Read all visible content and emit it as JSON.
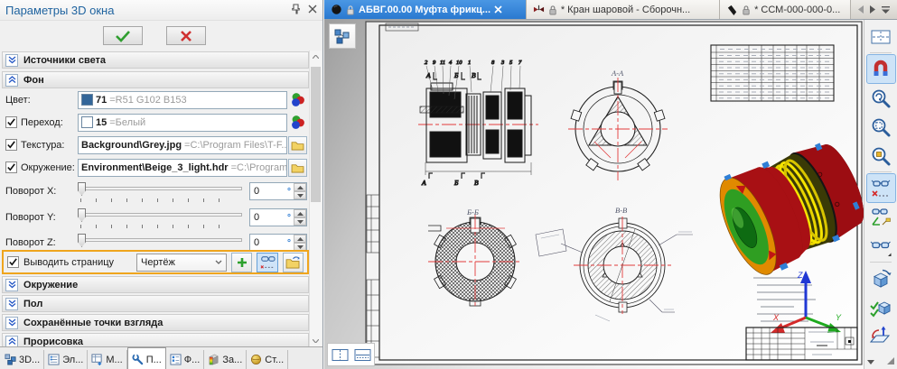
{
  "panel": {
    "title": "Параметры 3D окна",
    "sections": {
      "light_sources": "Источники света",
      "background": "Фон",
      "environment": "Окружение",
      "floor": "Пол",
      "saved_views": "Сохранённые точки взгляда",
      "rendering": "Прорисовка"
    },
    "fields": {
      "color": {
        "label": "Цвет:",
        "value": "71",
        "extra": "=R51 G102 B153",
        "swatch": "#336699"
      },
      "transition": {
        "label": "Переход:",
        "checked": true,
        "value": "15",
        "extra": "=Белый",
        "swatch": "#FFFFFF"
      },
      "texture": {
        "label": "Текстура:",
        "checked": true,
        "value": "Background\\Grey.jpg",
        "extra": "=C:\\Program Files\\T-F..."
      },
      "environment": {
        "label": "Окружение:",
        "checked": true,
        "value": "Environment\\Beige_3_light.hdr",
        "extra": "=C:\\Program..."
      },
      "rotate_x": {
        "label": "Поворот X:",
        "value": "0",
        "unit": "°"
      },
      "rotate_y": {
        "label": "Поворот Y:",
        "value": "0",
        "unit": "°"
      },
      "rotate_z": {
        "label": "Поворот Z:",
        "value": "0",
        "unit": "°"
      },
      "output_page": {
        "label": "Выводить страницу",
        "checked": true,
        "value": "Чертёж"
      }
    },
    "bottom_tabs": [
      {
        "label": "3D..."
      },
      {
        "label": "Эл..."
      },
      {
        "label": "М..."
      },
      {
        "label": "П...",
        "active": true
      },
      {
        "label": "Ф..."
      },
      {
        "label": "За..."
      },
      {
        "label": "Ст..."
      }
    ]
  },
  "document_tabs": [
    {
      "title": "АБВГ.00.00 Муфта фрикц...",
      "active": true
    },
    {
      "title": "* Кран шаровой - Сборочн..."
    },
    {
      "title": "* ССМ-000-000-0..."
    }
  ],
  "drawing": {
    "view_labels": {
      "aa": "А-А",
      "bb": "Б-Б",
      "vv": "В-В"
    },
    "position_numbers": [
      "2",
      "9",
      "11",
      "4",
      "10",
      "1",
      "8",
      "3",
      "5",
      "7"
    ],
    "section_marks_top": [
      "А",
      "Б",
      "В"
    ],
    "section_marks_bottom": [
      "А",
      "Б",
      "В"
    ],
    "axes": {
      "x": "X",
      "y": "Y",
      "z": "Z"
    }
  },
  "right_toolbar": {
    "icons": [
      "page-setup",
      "magnet-snap",
      "zoom-dynamic",
      "zoom-extents",
      "zoom-window",
      "hide-elements",
      "measure-elements",
      "visibility",
      "rotate-view-cube",
      "check-model",
      "rotate-workplane"
    ]
  },
  "colors": {
    "accent_blue": "#2b7cd3",
    "highlight_orange": "#efa51d",
    "background_swatch": "#336699",
    "axis_x": "#d42a2a",
    "axis_y": "#1faa1f",
    "axis_z": "#2038d4"
  }
}
